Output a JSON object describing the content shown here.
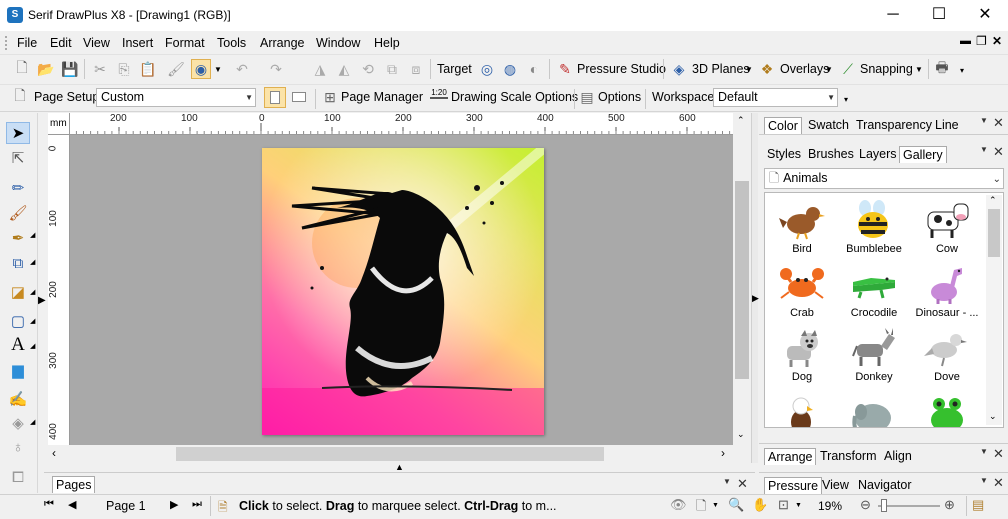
{
  "title": "Serif DrawPlus X8 - [Drawing1 (RGB)]",
  "window_controls": {
    "minimize": "─",
    "maximize": "☐",
    "close": "✕"
  },
  "menu": [
    "File",
    "Edit",
    "View",
    "Insert",
    "Format",
    "Tools",
    "Arrange",
    "Window",
    "Help"
  ],
  "toolbar1": {
    "target": "Target",
    "pressure_studio": "Pressure Studio",
    "planes": "3D Planes",
    "overlays": "Overlays",
    "snapping": "Snapping"
  },
  "toolbar2": {
    "page_setup": "Page Setup",
    "page_setup_value": "Custom",
    "page_manager": "Page Manager",
    "scale_ratio": "1:20",
    "drawing_scale": "Drawing Scale Options",
    "options": "Options",
    "workspace": "Workspace",
    "workspace_value": "Default"
  },
  "ruler": {
    "unit": "mm",
    "h_labels": [
      "200",
      "100",
      "0",
      "100",
      "200",
      "300",
      "400",
      "500",
      "600"
    ],
    "v_labels": [
      "0",
      "100",
      "200",
      "300",
      "400"
    ]
  },
  "color_panel": {
    "tabs": [
      "Color",
      "Swatch",
      "Transparency",
      "Line"
    ]
  },
  "gallery_panel": {
    "tabs": [
      "Styles",
      "Brushes",
      "Layers",
      "Gallery"
    ],
    "category": "Animals",
    "items": [
      "Bird",
      "Bumblebee",
      "Cow",
      "Crab",
      "Crocodile",
      "Dinosaur - ...",
      "Dog",
      "Donkey",
      "Dove"
    ]
  },
  "arrange_panel": {
    "tabs": [
      "Arrange",
      "Transform",
      "Align"
    ]
  },
  "pressure_panel": {
    "tabs": [
      "Pressure",
      "View",
      "Navigator"
    ]
  },
  "pages_panel": {
    "tab": "Pages"
  },
  "status": {
    "page": "Page 1",
    "hint_bold": "Click",
    "hint_1": " to select. ",
    "hint_bold2": "Drag",
    "hint_2": " to marquee select. ",
    "hint_bold3": "Ctrl-Drag",
    "hint_3": " to m...",
    "zoom": "19%"
  },
  "colors": {
    "accent": "#1e73be",
    "selection": "#c9def5"
  }
}
